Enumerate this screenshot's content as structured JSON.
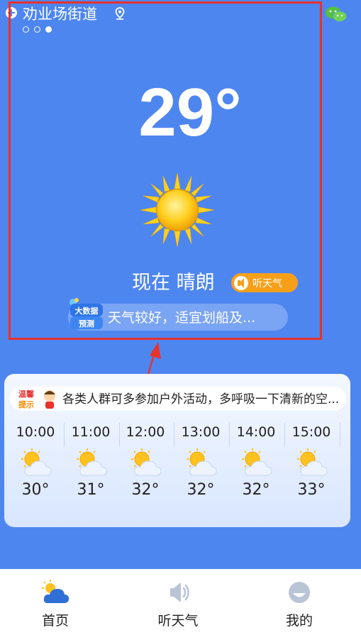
{
  "header": {
    "city": "劝业场街道",
    "page_dots": [
      false,
      false,
      true
    ]
  },
  "current": {
    "temperature": "29°",
    "status_text": "现在 晴朗",
    "listen_label": "听天气",
    "bigdata_badge": [
      "大数据",
      "预测"
    ],
    "tip": "天气较好，适宜划船及..."
  },
  "hourly_card": {
    "warm_badge": [
      "温馨",
      "提示"
    ],
    "notice": "各类人群可多参加户外活动，多呼吸一下清新的空...",
    "hours": [
      {
        "time": "10:00",
        "icon": "sun-cloud-icon",
        "temp": "30°"
      },
      {
        "time": "11:00",
        "icon": "sun-cloud-icon",
        "temp": "31°"
      },
      {
        "time": "12:00",
        "icon": "sun-cloud-icon",
        "temp": "32°"
      },
      {
        "time": "13:00",
        "icon": "sun-cloud-icon",
        "temp": "32°"
      },
      {
        "time": "14:00",
        "icon": "sun-cloud-icon",
        "temp": "32°"
      },
      {
        "time": "15:00",
        "icon": "sun-cloud-icon",
        "temp": "33°"
      }
    ]
  },
  "tabbar": {
    "tabs": [
      {
        "label": "首页",
        "icon": "home-weather-icon",
        "active": true
      },
      {
        "label": "听天气",
        "icon": "speaker-icon",
        "active": false
      },
      {
        "label": "我的",
        "icon": "profile-icon",
        "active": false
      }
    ]
  },
  "colors": {
    "background": "#4e86f0",
    "accent_orange": "#f6a01a",
    "highlight_frame": "#e8322c"
  }
}
